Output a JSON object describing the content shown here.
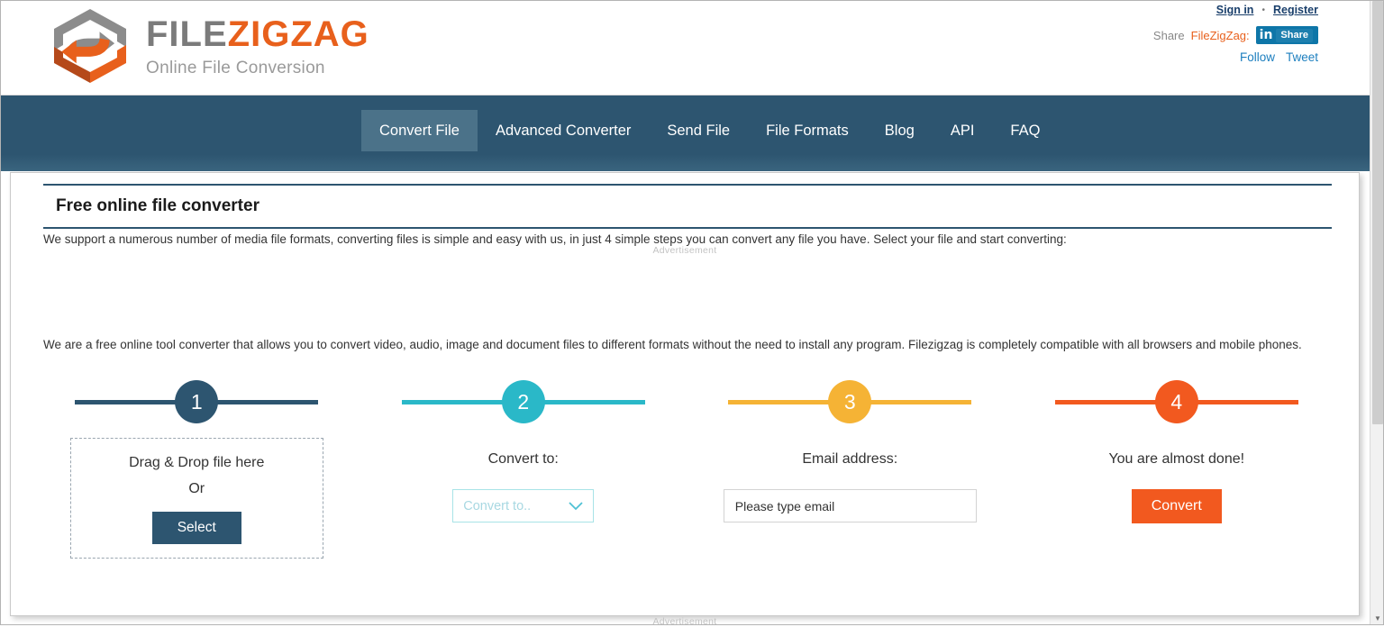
{
  "header": {
    "logo": {
      "name_part1": "FILE",
      "name_part2": "ZIGZAG",
      "tagline": "Online File Conversion",
      "mark_icon": "zigzag-hexagon-logo-icon"
    },
    "account": {
      "sign_in": "Sign in",
      "separator": "•",
      "register": "Register"
    },
    "share": {
      "prefix": "Share ",
      "brand": "FileZigZag:",
      "linkedin_mark": "in",
      "linkedin_label": "Share",
      "follow": "Follow",
      "tweet": "Tweet"
    }
  },
  "nav": {
    "items": [
      {
        "label": "Convert File",
        "active": true
      },
      {
        "label": "Advanced Converter",
        "active": false
      },
      {
        "label": "Send File",
        "active": false
      },
      {
        "label": "File Formats",
        "active": false
      },
      {
        "label": "Blog",
        "active": false
      },
      {
        "label": "API",
        "active": false
      },
      {
        "label": "FAQ",
        "active": false
      }
    ]
  },
  "main": {
    "page_title": "Free online file converter",
    "intro": "We support a numerous number of media file formats, converting files is simple and easy with us, in just 4 simple steps you can convert any file you have. Select your file and start converting:",
    "ad_label_top": "Advertisement",
    "ad_label_bottom": "Advertisement",
    "blurb": "We are a free online tool converter that allows you to convert video, audio, image and document files to different formats without the need to install any program. Filezigzag is completely compatible with all browsers and mobile phones.",
    "steps": [
      {
        "number": "1",
        "color": "#2d5570",
        "caption": "",
        "dropzone_line1": "Drag & Drop file here",
        "dropzone_or": "Or",
        "select_button": "Select"
      },
      {
        "number": "2",
        "color": "#2ab8c8",
        "caption": "Convert to:",
        "select_value": "Convert to..",
        "chevron_icon": "chevron-down-icon"
      },
      {
        "number": "3",
        "color": "#f5b335",
        "caption": "Email address:",
        "email_placeholder": "Please type email",
        "email_value": "Please type email"
      },
      {
        "number": "4",
        "color": "#f2591f",
        "caption": "You are almost done!",
        "convert_button": "Convert"
      }
    ]
  },
  "scrollbar": {
    "up_arrow": "▲",
    "down_arrow": "▼"
  },
  "colors": {
    "nav_bg": "#2d5570",
    "nav_active": "#4b7289",
    "brand_orange": "#e8601c",
    "brand_gray": "#7b7b7b",
    "accent_teal": "#2ab8c8",
    "accent_yellow": "#f5b335",
    "accent_orange": "#f2591f",
    "link_blue": "#1d7fbf"
  }
}
